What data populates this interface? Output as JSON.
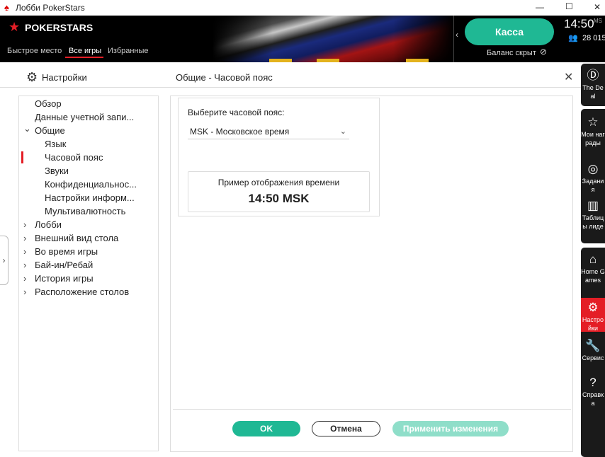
{
  "window": {
    "title": "Лобби PokerStars",
    "minimize": "—",
    "maximize": "☐",
    "close": "✕"
  },
  "header": {
    "logo": "POKERSTARS",
    "nav": [
      "Быстрое место",
      "Все игры",
      "Избранные"
    ],
    "active_nav": "Все игры",
    "cashier": "Касса",
    "balance": "Баланс скрыт",
    "time": "14:50",
    "time_suffix": "MS",
    "players": "28 015",
    "accent": "#1fb894"
  },
  "settings": {
    "title": "Настройки",
    "page_title": "Общие - Часовой пояс",
    "close": "✕",
    "tree": [
      {
        "label": "Обзор",
        "level": 0,
        "arrow": ""
      },
      {
        "label": "Данные учетной запи...",
        "level": 0,
        "arrow": ""
      },
      {
        "label": "Общие",
        "level": 0,
        "arrow": "⌄"
      },
      {
        "label": "Язык",
        "level": 1,
        "arrow": ""
      },
      {
        "label": "Часовой пояс",
        "level": 1,
        "arrow": "",
        "selected": true
      },
      {
        "label": "Звуки",
        "level": 1,
        "arrow": ""
      },
      {
        "label": "Конфиденциальнос...",
        "level": 1,
        "arrow": ""
      },
      {
        "label": "Настройки информ...",
        "level": 1,
        "arrow": ""
      },
      {
        "label": "Мультивалютность",
        "level": 1,
        "arrow": ""
      },
      {
        "label": "Лобби",
        "level": 0,
        "arrow": "›"
      },
      {
        "label": "Внешний вид стола",
        "level": 0,
        "arrow": "›"
      },
      {
        "label": "Во время игры",
        "level": 0,
        "arrow": "›"
      },
      {
        "label": "Бай-ин/Ребай",
        "level": 0,
        "arrow": "›"
      },
      {
        "label": "История игры",
        "level": 0,
        "arrow": "›"
      },
      {
        "label": "Расположение столов",
        "level": 0,
        "arrow": "›"
      }
    ],
    "timezone_label": "Выберите часовой пояс:",
    "timezone_value": "MSK - Московское время",
    "preview_label": "Пример отображения времени",
    "preview_value": "14:50 MSK",
    "ok": "OK",
    "cancel": "Отмена",
    "apply": "Применить изменения"
  },
  "sidebar": [
    {
      "icon": "Ⓓ",
      "label": "The Deal"
    },
    {
      "icon": "☆",
      "label": "Мои награды"
    },
    {
      "icon": "◎",
      "label": "Задания"
    },
    {
      "icon": "▥",
      "label": "Таблицы лидеров"
    },
    {
      "icon": "⌂",
      "label": "Home Games"
    },
    {
      "icon": "⚙",
      "label": "Настройки"
    },
    {
      "icon": "🔧",
      "label": "Сервис"
    },
    {
      "icon": "?",
      "label": "Справка"
    }
  ]
}
